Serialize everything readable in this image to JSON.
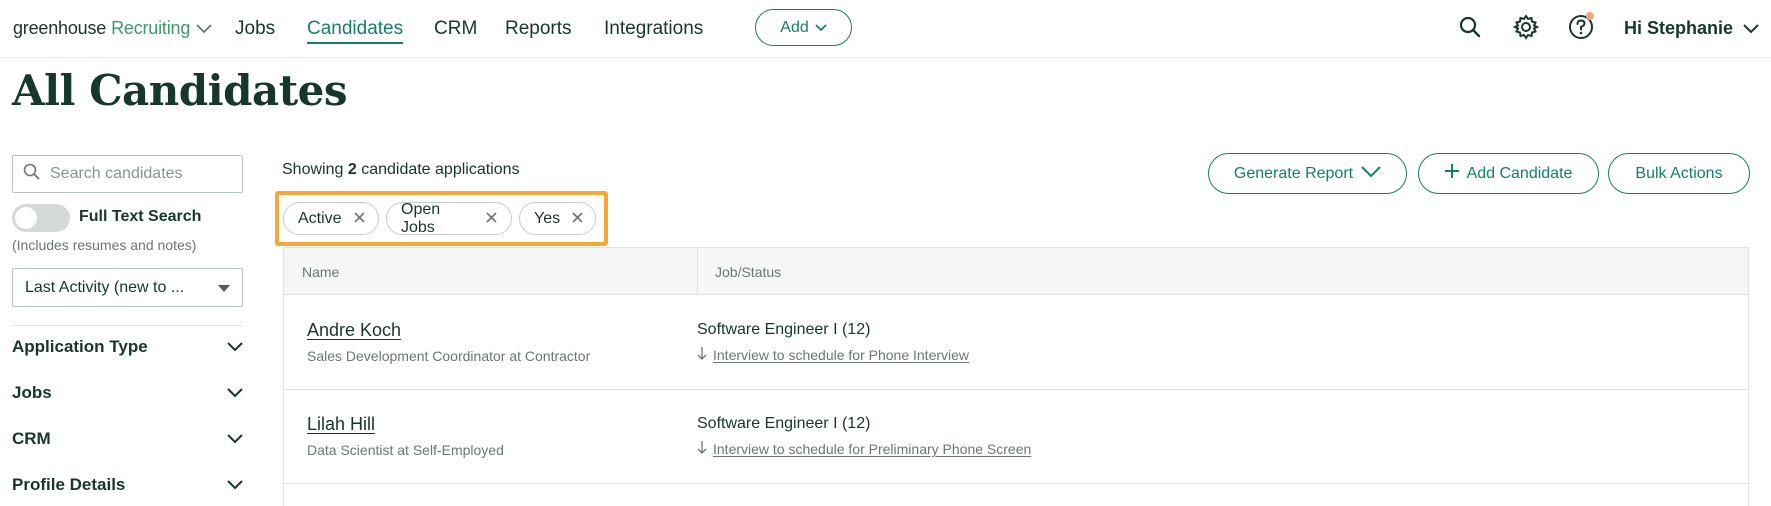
{
  "nav": {
    "brand_main": "greenhouse",
    "brand_sub": "Recruiting",
    "links": [
      "Jobs",
      "Candidates",
      "CRM",
      "Reports",
      "Integrations"
    ],
    "active": "Candidates",
    "add_label": "Add",
    "greeting": "Hi Stephanie"
  },
  "page": {
    "title": "All Candidates"
  },
  "sidebar": {
    "search_placeholder": "Search candidates",
    "full_text_label": "Full Text Search",
    "full_text_note": "(Includes resumes and notes)",
    "sort_value": "Last Activity (new to ...",
    "filters": [
      "Application Type",
      "Jobs",
      "CRM",
      "Profile Details"
    ]
  },
  "main": {
    "showing_prefix": "Showing",
    "showing_count": "2",
    "showing_suffix": "candidate applications",
    "buttons": {
      "generate_report": "Generate Report",
      "add_candidate": "Add Candidate",
      "bulk_actions": "Bulk Actions"
    },
    "chips": [
      "Active",
      "Open Jobs",
      "Yes"
    ],
    "columns": [
      "Name",
      "Job/Status"
    ],
    "rows": [
      {
        "name": "Andre Koch",
        "subtitle": "Sales Development Coordinator at Contractor",
        "job": "Software Engineer I (12)",
        "status": "Interview to schedule for Phone Interview"
      },
      {
        "name": "Lilah Hill",
        "subtitle": "Data Scientist at Self-Employed",
        "job": "Software Engineer I (12)",
        "status": "Interview to schedule for Preliminary Phone Screen"
      }
    ]
  },
  "colors": {
    "brand_green": "#14806a",
    "text_dark": "#15372c",
    "highlight_orange": "#f7a637",
    "notification_dot": "#f4a787"
  }
}
